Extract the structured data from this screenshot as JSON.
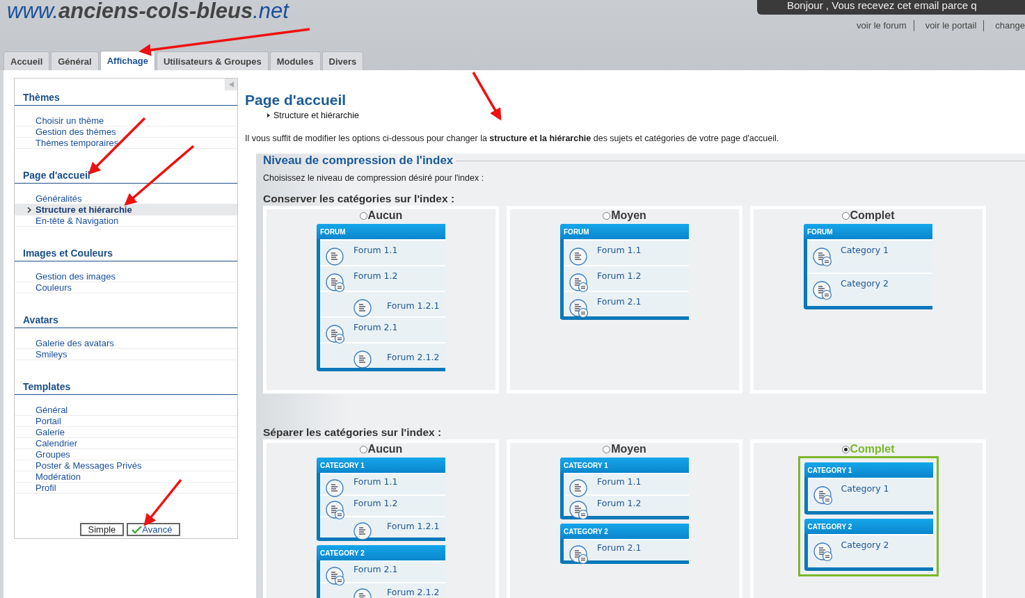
{
  "site": {
    "logo_prefix": "www.",
    "logo_name": "anciens-cols-bleus",
    "logo_suffix": ".net",
    "notice": "Bonjour , Vous recevez cet email parce q",
    "links": [
      "voir le forum",
      "voir le portail",
      "change"
    ]
  },
  "tabs": [
    {
      "label": "Accueil",
      "selected": false
    },
    {
      "label": "Général",
      "selected": false
    },
    {
      "label": "Affichage",
      "selected": true
    },
    {
      "label": "Utilisateurs & Groupes",
      "selected": false
    },
    {
      "label": "Modules",
      "selected": false
    },
    {
      "label": "Divers",
      "selected": false
    }
  ],
  "sidebar": {
    "groups": [
      {
        "title": "Thèmes",
        "items": [
          {
            "label": "Choisir un thème",
            "selected": false
          },
          {
            "label": "Gestion des thèmes",
            "selected": false
          },
          {
            "label": "Thèmes temporaires",
            "selected": false
          }
        ]
      },
      {
        "title": "Page d'accueil",
        "items": [
          {
            "label": "Généralités",
            "selected": false
          },
          {
            "label": "Structure et hiérarchie",
            "selected": true
          },
          {
            "label": "En-tête & Navigation",
            "selected": false
          }
        ]
      },
      {
        "title": "Images et Couleurs",
        "items": [
          {
            "label": "Gestion des images",
            "selected": false
          },
          {
            "label": "Couleurs",
            "selected": false
          }
        ]
      },
      {
        "title": "Avatars",
        "items": [
          {
            "label": "Galerie des avatars",
            "selected": false
          },
          {
            "label": "Smileys",
            "selected": false
          }
        ]
      },
      {
        "title": "Templates",
        "items": [
          {
            "label": "Général",
            "selected": false
          },
          {
            "label": "Portail",
            "selected": false
          },
          {
            "label": "Galerie",
            "selected": false
          },
          {
            "label": "Calendrier",
            "selected": false
          },
          {
            "label": "Groupes",
            "selected": false
          },
          {
            "label": "Poster & Messages Privés",
            "selected": false
          },
          {
            "label": "Modération",
            "selected": false
          },
          {
            "label": "Profil",
            "selected": false
          }
        ]
      }
    ],
    "modes": [
      {
        "label": "Simple",
        "selected": false
      },
      {
        "label": "Avancé",
        "selected": true
      }
    ]
  },
  "main": {
    "title": "Page d'accueil",
    "breadcrumb": "Structure et hiérarchie",
    "description": "Il vous suffit de modifier les options ci-dessous pour changer la **structure et la hiérarchie** des sujets et catégories de votre page d'accueil.",
    "fieldset": {
      "legend": "Niveau de compression de l'index",
      "hint": "Choisissez le niveau de compression désiré pour l'index :",
      "sections": [
        {
          "title": "Conserver les catégories sur l'index :",
          "options": [
            {
              "label": "Aucun",
              "selected": false,
              "blocks": [
                {
                  "header": "FORUM",
                  "rows": [
                    {
                      "label": "Forum 1.1",
                      "kind": "forum",
                      "has_subforums": false
                    },
                    {
                      "label": "Forum 1.2",
                      "kind": "forum",
                      "has_subforums": true
                    },
                    {
                      "label": "Forum 1.2.1",
                      "kind": "subforum",
                      "has_subforums": false
                    },
                    {
                      "label": "Forum 2.1",
                      "kind": "forum",
                      "has_subforums": true
                    },
                    {
                      "label": "Forum 2.1.2",
                      "kind": "subforum",
                      "has_subforums": false
                    }
                  ]
                }
              ]
            },
            {
              "label": "Moyen",
              "selected": false,
              "blocks": [
                {
                  "header": "FORUM",
                  "rows": [
                    {
                      "label": "Forum 1.1",
                      "kind": "forum",
                      "has_subforums": false
                    },
                    {
                      "label": "Forum 1.2",
                      "kind": "forum",
                      "has_subforums": true
                    },
                    {
                      "label": "Forum 2.1",
                      "kind": "forum",
                      "has_subforums": true
                    }
                  ]
                }
              ]
            },
            {
              "label": "Complet",
              "selected": false,
              "blocks": [
                {
                  "header": "FORUM",
                  "rows": [
                    {
                      "label": "Category 1",
                      "kind": "category",
                      "has_subforums": true
                    },
                    {
                      "label": "Category 2",
                      "kind": "category",
                      "has_subforums": true
                    }
                  ]
                }
              ]
            }
          ]
        },
        {
          "title": "Séparer les catégories sur l'index :",
          "options": [
            {
              "label": "Aucun",
              "selected": false,
              "blocks": [
                {
                  "header": "CATEGORY 1",
                  "rows": [
                    {
                      "label": "Forum 1.1",
                      "kind": "forum",
                      "has_subforums": false
                    },
                    {
                      "label": "Forum 1.2",
                      "kind": "forum",
                      "has_subforums": true
                    },
                    {
                      "label": "Forum 1.2.1",
                      "kind": "subforum",
                      "has_subforums": false
                    }
                  ]
                },
                {
                  "header": "CATEGORY 2",
                  "rows": [
                    {
                      "label": "Forum 2.1",
                      "kind": "forum",
                      "has_subforums": true
                    },
                    {
                      "label": "Forum 2.1.2",
                      "kind": "subforum",
                      "has_subforums": false
                    }
                  ]
                }
              ]
            },
            {
              "label": "Moyen",
              "selected": false,
              "blocks": [
                {
                  "header": "CATEGORY 1",
                  "rows": [
                    {
                      "label": "Forum 1.1",
                      "kind": "forum",
                      "has_subforums": false
                    },
                    {
                      "label": "Forum 1.2",
                      "kind": "forum",
                      "has_subforums": true
                    }
                  ]
                },
                {
                  "header": "CATEGORY 2",
                  "rows": [
                    {
                      "label": "Forum 2.1",
                      "kind": "forum",
                      "has_subforums": true
                    }
                  ]
                }
              ]
            },
            {
              "label": "Complet",
              "selected": true,
              "blocks": [
                {
                  "header": "CATEGORY 1",
                  "rows": [
                    {
                      "label": "Category 1",
                      "kind": "category",
                      "has_subforums": true
                    }
                  ]
                },
                {
                  "header": "CATEGORY 2",
                  "rows": [
                    {
                      "label": "Category 2",
                      "kind": "category",
                      "has_subforums": true
                    }
                  ]
                }
              ]
            }
          ]
        }
      ]
    }
  }
}
